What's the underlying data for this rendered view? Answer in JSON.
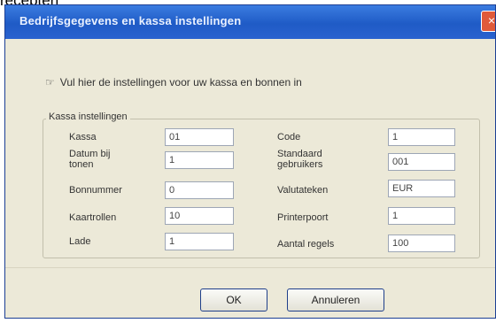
{
  "top_text": "recepten",
  "dialog": {
    "title": "Bedrijfsgegevens en kassa instellingen",
    "close_glyph": "×",
    "info_text": "Vul hier de instellingen voor uw kassa en bonnen in",
    "info_icon": "☞",
    "group_label": "Kassa instellingen",
    "fields": [
      {
        "label": "Kassa",
        "value": "01"
      },
      {
        "label": "Datum bij tonen",
        "value": "1"
      },
      {
        "label": "Bonnummer",
        "value": "0"
      },
      {
        "label": "Kaartrollen",
        "value": "10"
      },
      {
        "label": "Lade",
        "value": "1"
      },
      {
        "label": "Code",
        "value": "1"
      },
      {
        "label": "Standaard gebruikers",
        "value": "001"
      },
      {
        "label": "Valutateken",
        "value": "EUR"
      },
      {
        "label": "Printerpoort",
        "value": "1"
      },
      {
        "label": "Aantal regels",
        "value": "100"
      }
    ],
    "ok_label": "OK",
    "cancel_label": "Annuleren"
  }
}
